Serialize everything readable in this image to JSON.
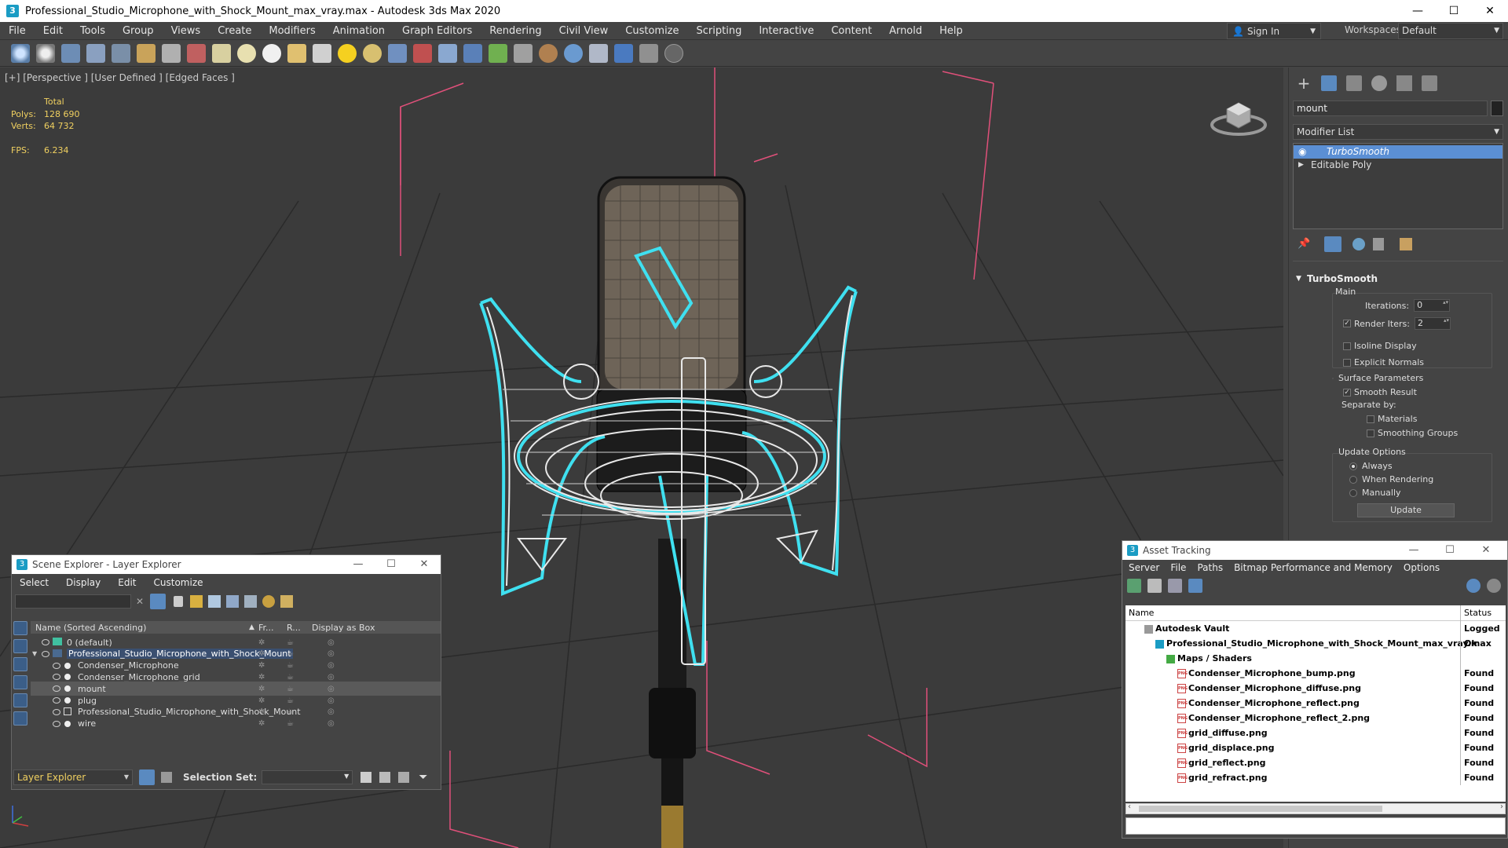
{
  "window": {
    "title": "Professional_Studio_Microphone_with_Shock_Mount_max_vray.max - Autodesk 3ds Max 2020",
    "app_icon": "3"
  },
  "menubar": [
    "File",
    "Edit",
    "Tools",
    "Group",
    "Views",
    "Create",
    "Modifiers",
    "Animation",
    "Graph Editors",
    "Rendering",
    "Civil View",
    "Customize",
    "Scripting",
    "Interactive",
    "Content",
    "Arnold",
    "Help"
  ],
  "account": {
    "sign_in": "Sign In",
    "workspaces_label": "Workspaces:",
    "workspace": "Default"
  },
  "viewport": {
    "label": "[+] [Perspective ] [User Defined ] [Edged Faces ]",
    "stats": {
      "header": "Total",
      "polys_label": "Polys:",
      "polys": "128 690",
      "verts_label": "Verts:",
      "verts": "64 732",
      "fps_label": "FPS:",
      "fps": "6.234"
    }
  },
  "command_panel": {
    "object_name": "mount",
    "modifier_list": "Modifier List",
    "stack": [
      {
        "label": "TurboSmooth",
        "selected": true
      },
      {
        "label": "Editable Poly",
        "selected": false
      }
    ],
    "rollout": {
      "title": "TurboSmooth",
      "main_label": "Main",
      "iterations_label": "Iterations:",
      "iterations": "0",
      "render_iters_label": "Render Iters:",
      "render_iters": "2",
      "isoline": "Isoline Display",
      "explicit_normals": "Explicit Normals",
      "surface_params": "Surface Parameters",
      "smooth_result": "Smooth Result",
      "separate_by": "Separate by:",
      "materials": "Materials",
      "smoothing_groups": "Smoothing Groups",
      "update_options": "Update Options",
      "always": "Always",
      "when_rendering": "When Rendering",
      "manually": "Manually",
      "update_button": "Update"
    }
  },
  "scene_explorer": {
    "title": "Scene Explorer - Layer Explorer",
    "menu": [
      "Select",
      "Display",
      "Edit",
      "Customize"
    ],
    "columns": {
      "name": "Name (Sorted Ascending)",
      "frozen": "Fr...",
      "render": "R...",
      "box": "Display as Box"
    },
    "rows": [
      {
        "label": "0 (default)",
        "indent": 0,
        "type": "layer"
      },
      {
        "label": "Professional_Studio_Microphone_with_Shock_Mount",
        "indent": 0,
        "type": "layer-active"
      },
      {
        "label": "Condenser_Microphone",
        "indent": 1,
        "type": "object"
      },
      {
        "label": "Condenser_Microphone_grid",
        "indent": 1,
        "type": "object"
      },
      {
        "label": "mount",
        "indent": 1,
        "type": "object-selected"
      },
      {
        "label": "plug",
        "indent": 1,
        "type": "object"
      },
      {
        "label": "Professional_Studio_Microphone_with_Shock_Mount",
        "indent": 1,
        "type": "group"
      },
      {
        "label": "wire",
        "indent": 1,
        "type": "object"
      }
    ],
    "footer": {
      "explorer": "Layer Explorer",
      "selection_set_label": "Selection Set:"
    }
  },
  "asset_tracking": {
    "title": "Asset Tracking",
    "menu": [
      "Server",
      "File",
      "Paths",
      "Bitmap Performance and Memory",
      "Options"
    ],
    "columns": {
      "name": "Name",
      "status": "Status"
    },
    "rows": [
      {
        "name": "Autodesk Vault",
        "status": "Logged O",
        "indent": 0,
        "icon": "vault"
      },
      {
        "name": "Professional_Studio_Microphone_with_Shock_Mount_max_vray.max",
        "status": "Ok",
        "indent": 1,
        "icon": "max"
      },
      {
        "name": "Maps / Shaders",
        "status": "",
        "indent": 2,
        "icon": "maps"
      },
      {
        "name": "Condenser_Microphone_bump.png",
        "status": "Found",
        "indent": 3,
        "icon": "png"
      },
      {
        "name": "Condenser_Microphone_diffuse.png",
        "status": "Found",
        "indent": 3,
        "icon": "png"
      },
      {
        "name": "Condenser_Microphone_reflect.png",
        "status": "Found",
        "indent": 3,
        "icon": "png"
      },
      {
        "name": "Condenser_Microphone_reflect_2.png",
        "status": "Found",
        "indent": 3,
        "icon": "png"
      },
      {
        "name": "grid_diffuse.png",
        "status": "Found",
        "indent": 3,
        "icon": "png"
      },
      {
        "name": "grid_displace.png",
        "status": "Found",
        "indent": 3,
        "icon": "png"
      },
      {
        "name": "grid_reflect.png",
        "status": "Found",
        "indent": 3,
        "icon": "png"
      },
      {
        "name": "grid_refract.png",
        "status": "Found",
        "indent": 3,
        "icon": "png"
      }
    ]
  },
  "colors": {
    "selection_blue": "#5b8fd4",
    "wire_cyan": "#3fe0f0",
    "bounding_pink": "#e0507a",
    "stats_yellow": "#f0d060"
  }
}
